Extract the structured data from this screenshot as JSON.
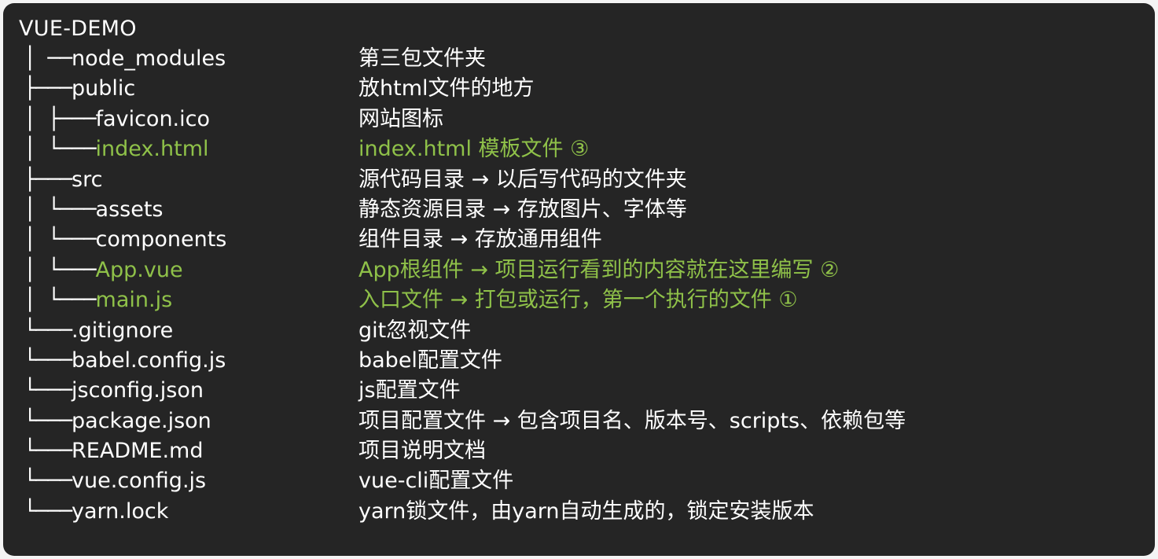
{
  "root": "VUE-DEMO",
  "colors": {
    "background": "#252525",
    "text": "#ffffff",
    "highlight": "#8fc149"
  },
  "rows": [
    {
      "prefix": "│ ──",
      "name": "node_modules",
      "desc": "第三包文件夹",
      "highlight": false
    },
    {
      "prefix": "├───",
      "name": "public",
      "desc": "放html文件的地方",
      "highlight": false
    },
    {
      "prefix": "│   ├───",
      "name": "favicon.ico",
      "desc": "网站图标",
      "highlight": false
    },
    {
      "prefix": "│   └───",
      "name": "index.html",
      "desc": "index.html 模板文件 ③",
      "highlight": true
    },
    {
      "prefix": "├───",
      "name": "src",
      "desc": "源代码目录 → 以后写代码的文件夹",
      "highlight": false
    },
    {
      "prefix": "│   └───",
      "name": "assets",
      "desc": "静态资源目录 → 存放图片、字体等",
      "highlight": false
    },
    {
      "prefix": "│   └───",
      "name": "components",
      "desc": "组件目录 → 存放通用组件",
      "highlight": false
    },
    {
      "prefix": "│   └───",
      "name": "App.vue",
      "desc": "App根组件 → 项目运行看到的内容就在这里编写 ②",
      "highlight": true
    },
    {
      "prefix": "│   └───",
      "name": "main.js",
      "desc": "入口文件 → 打包或运行，第一个执行的文件 ①",
      "highlight": true
    },
    {
      "prefix": "└───",
      "name": ".gitignore",
      "desc": "git忽视文件",
      "highlight": false
    },
    {
      "prefix": "└───",
      "name": "babel.config.js",
      "desc": "babel配置文件",
      "highlight": false
    },
    {
      "prefix": "└───",
      "name": "jsconfig.json",
      "desc": "js配置文件",
      "highlight": false
    },
    {
      "prefix": "└───",
      "name": "package.json",
      "desc": "项目配置文件 → 包含项目名、版本号、scripts、依赖包等",
      "highlight": false
    },
    {
      "prefix": "└───",
      "name": "README.md",
      "desc": "项目说明文档",
      "highlight": false
    },
    {
      "prefix": "└───",
      "name": "vue.config.js",
      "desc": "vue-cli配置文件",
      "highlight": false
    },
    {
      "prefix": "└───",
      "name": "yarn.lock",
      "desc": "yarn锁文件，由yarn自动生成的，锁定安装版本",
      "highlight": false
    }
  ]
}
